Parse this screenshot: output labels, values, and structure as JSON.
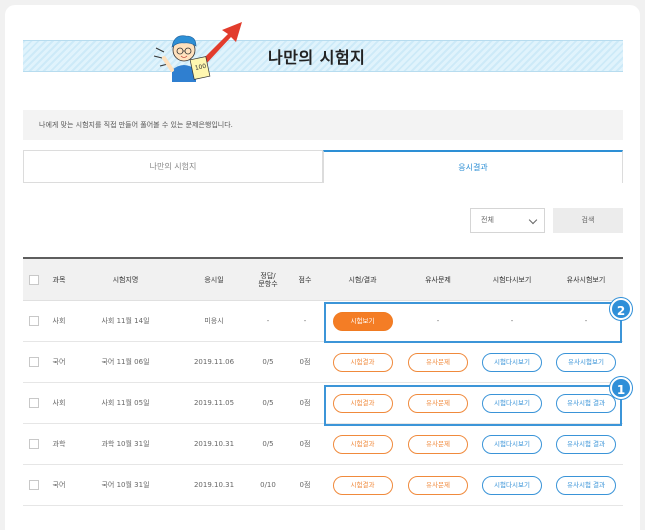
{
  "page": {
    "title": "나만의 시험지"
  },
  "description": "나에게 맞는 시험지를 직접 만들어 풀어볼 수 있는 문제은행입니다.",
  "tabs": [
    {
      "label": "나만의 시험지",
      "active": false
    },
    {
      "label": "응시결과",
      "active": true
    }
  ],
  "filter": {
    "selected": "전체"
  },
  "search_button": "검색",
  "table": {
    "headers": {
      "subject": "과목",
      "exam_name": "시험지명",
      "exam_date": "응시일",
      "score_ratio_1": "정답/",
      "score_ratio_2": "문항수",
      "score": "점수",
      "exam_result": "시험/결과",
      "similar": "유사문제",
      "review": "시험다시보기",
      "similar_exam": "유사시험보기"
    },
    "rows": [
      {
        "subject": "사회",
        "name": "사회 11월 14일",
        "date": "미응시",
        "ratio": "-",
        "score": "-",
        "exam_btn": "시험보기",
        "similar": "-",
        "review": "-",
        "similar_exam": "-"
      },
      {
        "subject": "국어",
        "name": "국어 11월 06일",
        "date": "2019.11.06",
        "ratio": "0/5",
        "score": "0점",
        "exam_btn": "시험결과",
        "similar": "유사문제",
        "review": "시험다시보기",
        "similar_exam": "유사시험보기"
      },
      {
        "subject": "사회",
        "name": "사회 11월 05일",
        "date": "2019.11.05",
        "ratio": "0/5",
        "score": "0점",
        "exam_btn": "시험결과",
        "similar": "유사문제",
        "review": "시험다시보기",
        "similar_exam": "유사시험 결과"
      },
      {
        "subject": "과학",
        "name": "과학 10월 31일",
        "date": "2019.10.31",
        "ratio": "0/5",
        "score": "0점",
        "exam_btn": "시험결과",
        "similar": "유사문제",
        "review": "시험다시보기",
        "similar_exam": "유사시험 결과"
      },
      {
        "subject": "국어",
        "name": "국어 10월 31일",
        "date": "2019.10.31",
        "ratio": "0/10",
        "score": "0점",
        "exam_btn": "시험결과",
        "similar": "유사문제",
        "review": "시험다시보기",
        "similar_exam": "유사시험 결과"
      }
    ]
  },
  "annotations": {
    "badge_1": "1",
    "badge_2": "2"
  },
  "colors": {
    "accent_blue": "#2d8fd5",
    "accent_orange": "#f47d25"
  }
}
